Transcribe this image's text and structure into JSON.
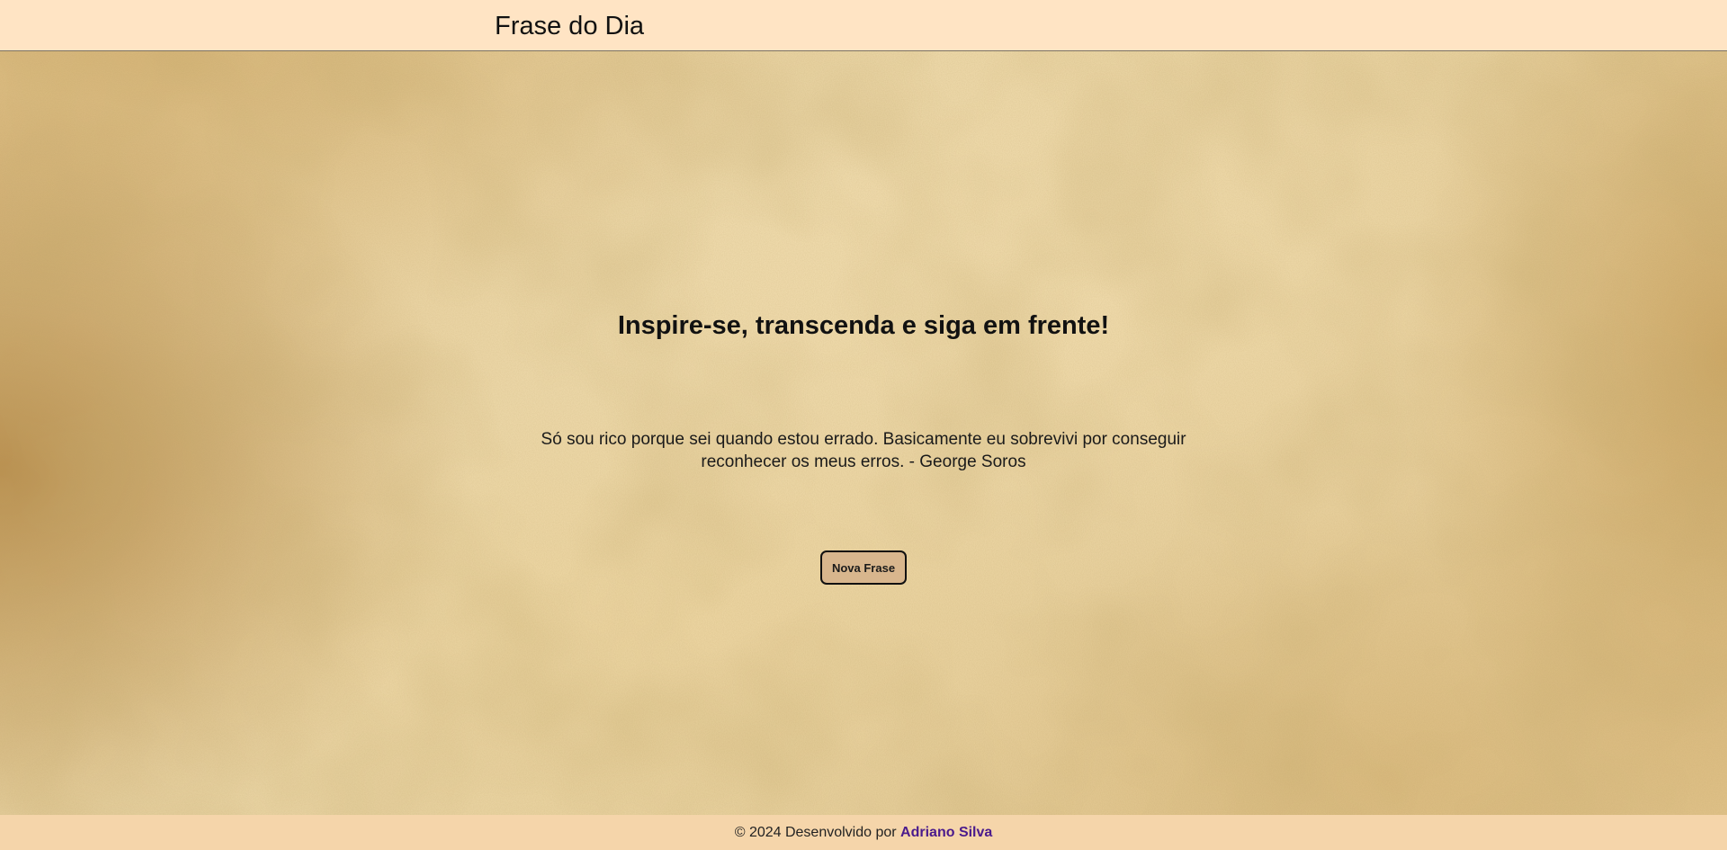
{
  "header": {
    "title": "Frase do Dia"
  },
  "main": {
    "headline": "Inspire-se, transcenda e siga em frente!",
    "quote": "Só sou rico porque sei quando estou errado. Basicamente eu sobrevivi por conseguir reconhecer os meus erros. - George Soros",
    "button_label": "Nova Frase"
  },
  "footer": {
    "copyright_text": "© 2024 Desenvolvido por ",
    "author_link": "Adriano Silva"
  },
  "colors": {
    "header_background": "#ffe4c4",
    "footer_background": "#f5d5aa",
    "button_background": "#d8b68d",
    "link_color": "#4a1a8c",
    "paper_background": "#e6cf9c"
  }
}
